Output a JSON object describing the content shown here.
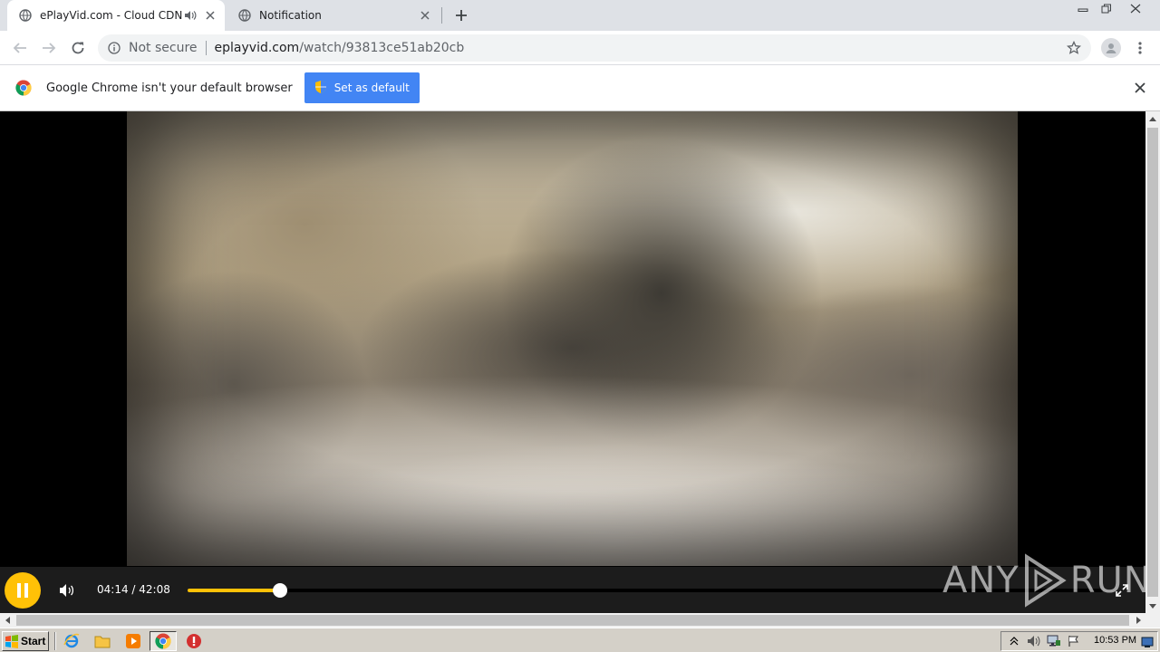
{
  "browser": {
    "tabs": [
      {
        "title": "ePlayVid.com - Cloud CDN",
        "active": true,
        "audio": true
      },
      {
        "title": "Notification",
        "active": false,
        "audio": false
      }
    ],
    "address": {
      "security_label": "Not secure",
      "host": "eplayvid.com",
      "path": "/watch/93813ce51ab20cb"
    },
    "infobar": {
      "message": "Google Chrome isn't your default browser",
      "button_label": "Set as default"
    }
  },
  "player": {
    "state": "playing",
    "current_time": "04:14",
    "duration": "42:08",
    "time_display": "04:14 / 42:08",
    "progress_fraction": 0.1005,
    "accent_color": "#ffc107"
  },
  "watermark": {
    "left_text": "ANY",
    "right_text": "RUN"
  },
  "taskbar": {
    "start_label": "Start",
    "quick_launch": [
      "ie-icon",
      "folder-icon",
      "media-player-icon",
      "chrome-icon",
      "stop-icon"
    ],
    "clock": "10:53 PM"
  }
}
